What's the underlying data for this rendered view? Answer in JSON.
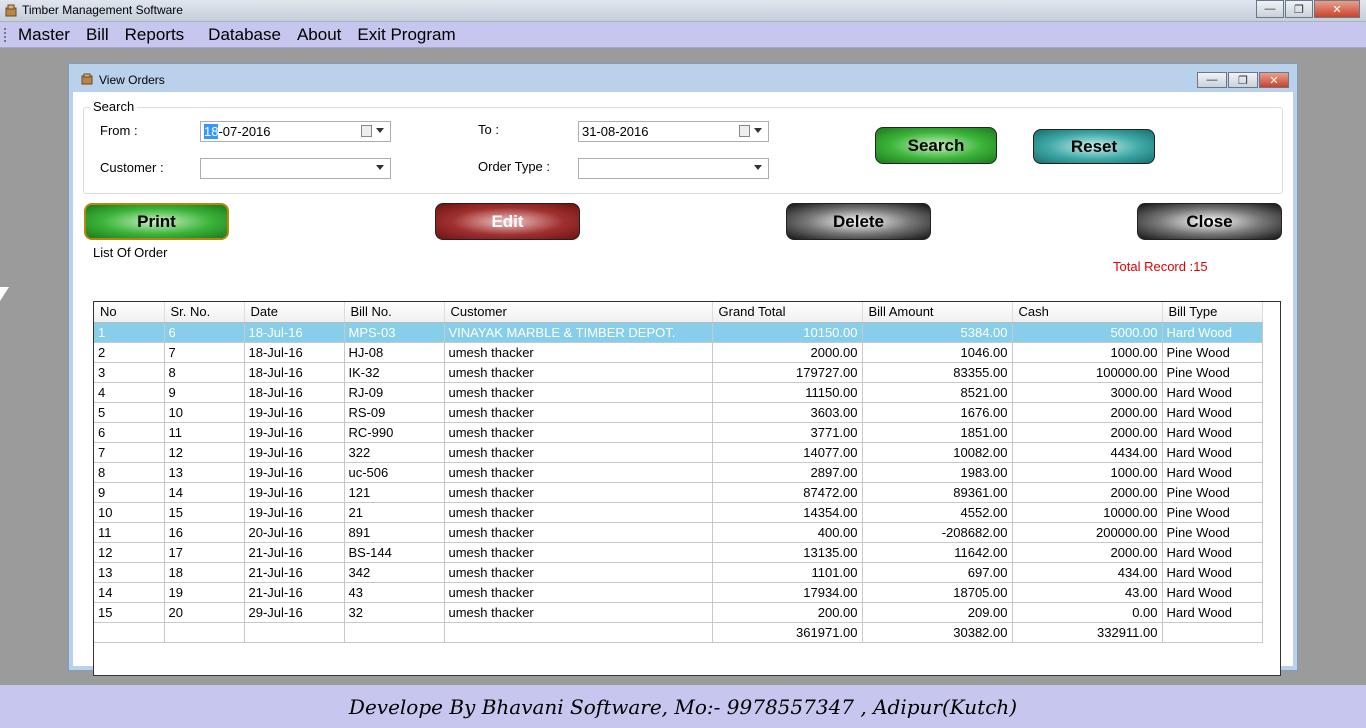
{
  "app": {
    "title": "Timber Management Software"
  },
  "menu": [
    "Master",
    "Bill",
    "Reports",
    "Database",
    "About",
    "Exit Program"
  ],
  "window": {
    "title": "View Orders"
  },
  "search": {
    "group_label": "Search",
    "from_label": "From :",
    "from_value_sel": "18",
    "from_value_rest": "-07-2016",
    "to_label": "To :",
    "to_value": "31-08-2016",
    "customer_label": "Customer :",
    "customer_value": "",
    "order_type_label": "Order Type :",
    "order_type_value": "",
    "search_btn": "Search",
    "reset_btn": "Reset"
  },
  "actions": {
    "print": "Print",
    "edit": "Edit",
    "delete": "Delete",
    "close": "Close"
  },
  "list": {
    "group_label": "List Of Order",
    "total_record": "Total Record :15",
    "columns": [
      "No",
      "Sr. No.",
      "Date",
      "Bill No.",
      "Customer",
      "Grand Total",
      "Bill Amount",
      "Cash",
      "Bill Type"
    ],
    "rows": [
      [
        "1",
        "6",
        "18-Jul-16",
        "MPS-03",
        "VINAYAK MARBLE & TIMBER DEPOT.",
        "10150.00",
        "5384.00",
        "5000.00",
        "Hard Wood"
      ],
      [
        "2",
        "7",
        "18-Jul-16",
        "HJ-08",
        "umesh thacker",
        "2000.00",
        "1046.00",
        "1000.00",
        "Pine Wood"
      ],
      [
        "3",
        "8",
        "18-Jul-16",
        "IK-32",
        "umesh thacker",
        "179727.00",
        "83355.00",
        "100000.00",
        "Pine Wood"
      ],
      [
        "4",
        "9",
        "18-Jul-16",
        "RJ-09",
        "umesh thacker",
        "11150.00",
        "8521.00",
        "3000.00",
        "Hard Wood"
      ],
      [
        "5",
        "10",
        "19-Jul-16",
        "RS-09",
        "umesh thacker",
        "3603.00",
        "1676.00",
        "2000.00",
        "Hard Wood"
      ],
      [
        "6",
        "11",
        "19-Jul-16",
        "RC-990",
        "umesh thacker",
        "3771.00",
        "1851.00",
        "2000.00",
        "Hard Wood"
      ],
      [
        "7",
        "12",
        "19-Jul-16",
        "322",
        "umesh thacker",
        "14077.00",
        "10082.00",
        "4434.00",
        "Hard Wood"
      ],
      [
        "8",
        "13",
        "19-Jul-16",
        "uc-506",
        "umesh thacker",
        "2897.00",
        "1983.00",
        "1000.00",
        "Hard Wood"
      ],
      [
        "9",
        "14",
        "19-Jul-16",
        "121",
        "umesh thacker",
        "87472.00",
        "89361.00",
        "2000.00",
        "Pine Wood"
      ],
      [
        "10",
        "15",
        "19-Jul-16",
        "21",
        "umesh thacker",
        "14354.00",
        "4552.00",
        "10000.00",
        "Pine Wood"
      ],
      [
        "11",
        "16",
        "20-Jul-16",
        "891",
        "umesh thacker",
        "400.00",
        "-208682.00",
        "200000.00",
        "Pine Wood"
      ],
      [
        "12",
        "17",
        "21-Jul-16",
        "BS-144",
        "umesh thacker",
        "13135.00",
        "11642.00",
        "2000.00",
        "Hard Wood"
      ],
      [
        "13",
        "18",
        "21-Jul-16",
        "342",
        "umesh thacker",
        "1101.00",
        "697.00",
        "434.00",
        "Hard Wood"
      ],
      [
        "14",
        "19",
        "21-Jul-16",
        "43",
        "umesh thacker",
        "17934.00",
        "18705.00",
        "43.00",
        "Hard Wood"
      ],
      [
        "15",
        "20",
        "29-Jul-16",
        "32",
        "umesh thacker",
        "200.00",
        "209.00",
        "0.00",
        "Hard Wood"
      ]
    ],
    "totals": [
      "",
      "",
      "",
      "",
      "",
      "361971.00",
      "30382.00",
      "332911.00",
      ""
    ]
  },
  "footer": {
    "text": "Develope By Bhavani Software, Mo:- 9978557347 , Adipur(Kutch)"
  },
  "colors": {
    "menubar": "#c6c6ee",
    "selected_row": "#87ceeb",
    "total_record": "#e00000"
  }
}
